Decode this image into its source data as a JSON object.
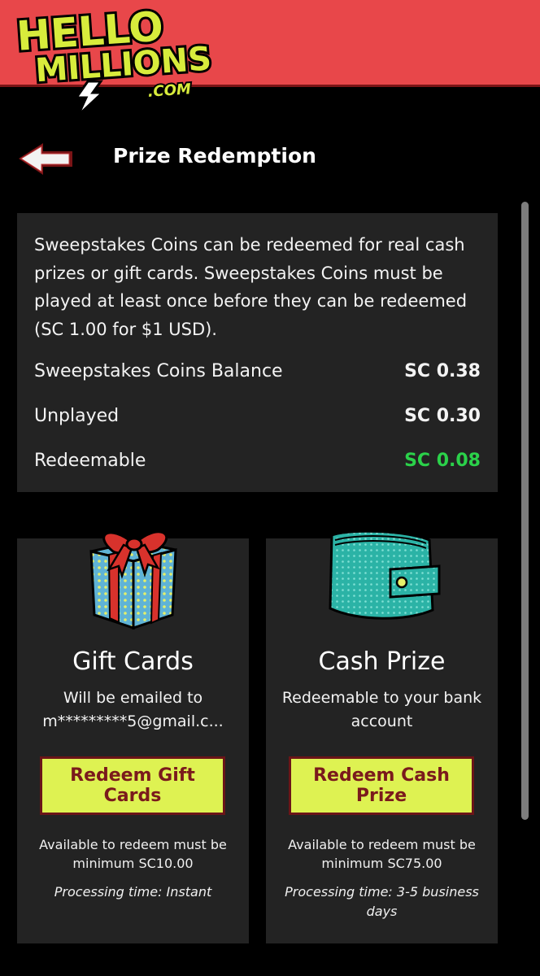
{
  "brand": {
    "logo_line1": "HELLO",
    "logo_line2": "MILLIONS",
    "logo_line3": ".COM",
    "top_bar_color": "#e8474a",
    "logo_color": "#d8ec3c"
  },
  "header": {
    "back_icon": "back-arrow-icon",
    "title": "Prize Redemption"
  },
  "info": {
    "description": "Sweepstakes Coins can be redeemed for real cash prizes or gift cards. Sweepstakes Coins must be played at least once before they can be redeemed (SC 1.00 for $1 USD).",
    "rows": [
      {
        "label": "Sweepstakes Coins Balance",
        "value": "SC 0.38"
      },
      {
        "label": "Unplayed",
        "value": "SC 0.30"
      },
      {
        "label": "Redeemable",
        "value": "SC 0.08",
        "color": "#2bd14a"
      }
    ]
  },
  "gift_card": {
    "icon": "gift-box-icon",
    "title": "Gift Cards",
    "subtitle_line1": "Will be emailed to",
    "subtitle_line2": "m*********5@gmail.c...",
    "button_label": "Redeem Gift Cards",
    "availability": "Available to redeem must be minimum SC10.00",
    "processing": "Processing time: Instant"
  },
  "cash_prize": {
    "icon": "wallet-icon",
    "title": "Cash Prize",
    "subtitle": "Redeemable to your bank account",
    "button_label": "Redeem Cash Prize",
    "availability": "Available to redeem must be minimum SC75.00",
    "processing": "Processing time: 3-5 business days"
  },
  "colors": {
    "button_bg": "#def252",
    "button_text": "#7a1a1c",
    "card_bg": "#232323"
  }
}
